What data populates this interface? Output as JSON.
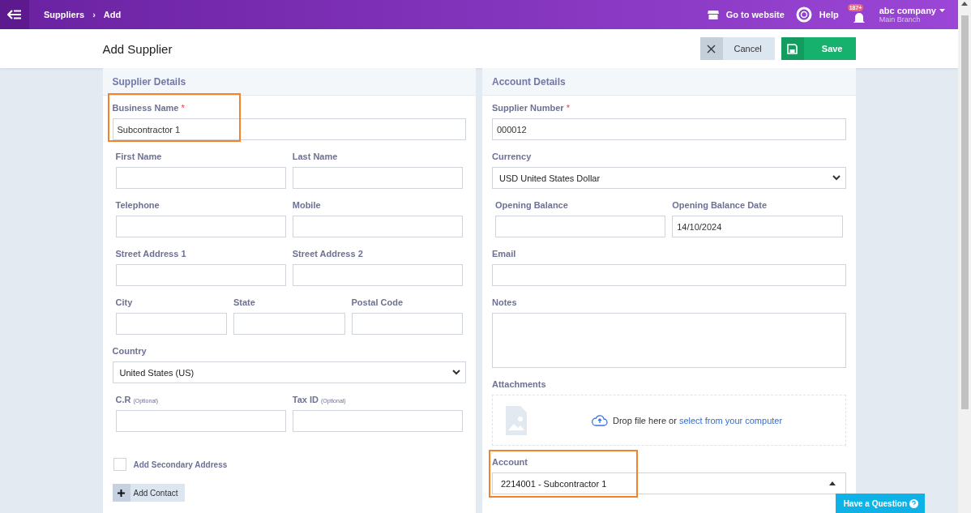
{
  "topbar": {
    "breadcrumb": [
      "Suppliers",
      "Add"
    ],
    "breadcrumb_separator": "›",
    "website_link": "Go to website",
    "help_link": "Help",
    "notification_count": "187+",
    "company": "abc company",
    "branch": "Main Branch"
  },
  "header": {
    "title": "Add Supplier",
    "cancel": "Cancel",
    "save": "Save"
  },
  "supplier_details": {
    "title": "Supplier Details",
    "rows": [
      {
        "fields": [
          {
            "kind": "text",
            "label": "Business Name",
            "required_mark": "*",
            "value": "Subcontractor 1",
            "highlighted": true
          }
        ]
      },
      {
        "fields": [
          {
            "kind": "text",
            "label": "First Name"
          },
          {
            "kind": "text",
            "label": "Last Name"
          }
        ]
      },
      {
        "fields": [
          {
            "kind": "text",
            "label": "Telephone"
          },
          {
            "kind": "text",
            "label": "Mobile"
          }
        ]
      },
      {
        "fields": [
          {
            "kind": "text",
            "label": "Street Address 1"
          },
          {
            "kind": "text",
            "label": "Street Address 2"
          }
        ]
      },
      {
        "fields": [
          {
            "kind": "text",
            "label": "City"
          },
          {
            "kind": "text",
            "label": "State"
          },
          {
            "kind": "text",
            "label": "Postal Code"
          }
        ]
      },
      {
        "fields": [
          {
            "kind": "select",
            "label": "Country",
            "value": "United States (US)"
          }
        ]
      },
      {
        "fields": [
          {
            "kind": "text",
            "label": "C.R",
            "note": "(Optional)"
          },
          {
            "kind": "text",
            "label": "Tax ID",
            "note": "(Optional)"
          }
        ]
      }
    ],
    "secondary_address": {
      "label": "Add Secondary Address",
      "checked": false
    },
    "add_contact": "Add Contact"
  },
  "account_details": {
    "title": "Account Details",
    "rows": [
      {
        "fields": [
          {
            "kind": "text",
            "label": "Supplier Number",
            "required_mark": "*",
            "value": "000012"
          }
        ]
      },
      {
        "fields": [
          {
            "kind": "select",
            "label": "Currency",
            "value": "USD United States Dollar"
          }
        ]
      },
      {
        "fields": [
          {
            "kind": "text",
            "label": "Opening Balance"
          },
          {
            "kind": "text",
            "label": "Opening Balance Date",
            "value": "14/10/2024"
          }
        ]
      },
      {
        "fields": [
          {
            "kind": "text",
            "label": "Email"
          }
        ]
      },
      {
        "fields": [
          {
            "kind": "textarea",
            "label": "Notes"
          }
        ]
      },
      {
        "fields": [
          {
            "kind": "dropzone",
            "label": "Attachments",
            "text": "Drop file here or ",
            "link": "select from your computer"
          }
        ]
      },
      {
        "fields": [
          {
            "kind": "combobox",
            "label": "Account",
            "value": "2214001 - Subcontractor 1",
            "highlighted": true
          }
        ]
      }
    ]
  },
  "help_button": "Have a Question"
}
